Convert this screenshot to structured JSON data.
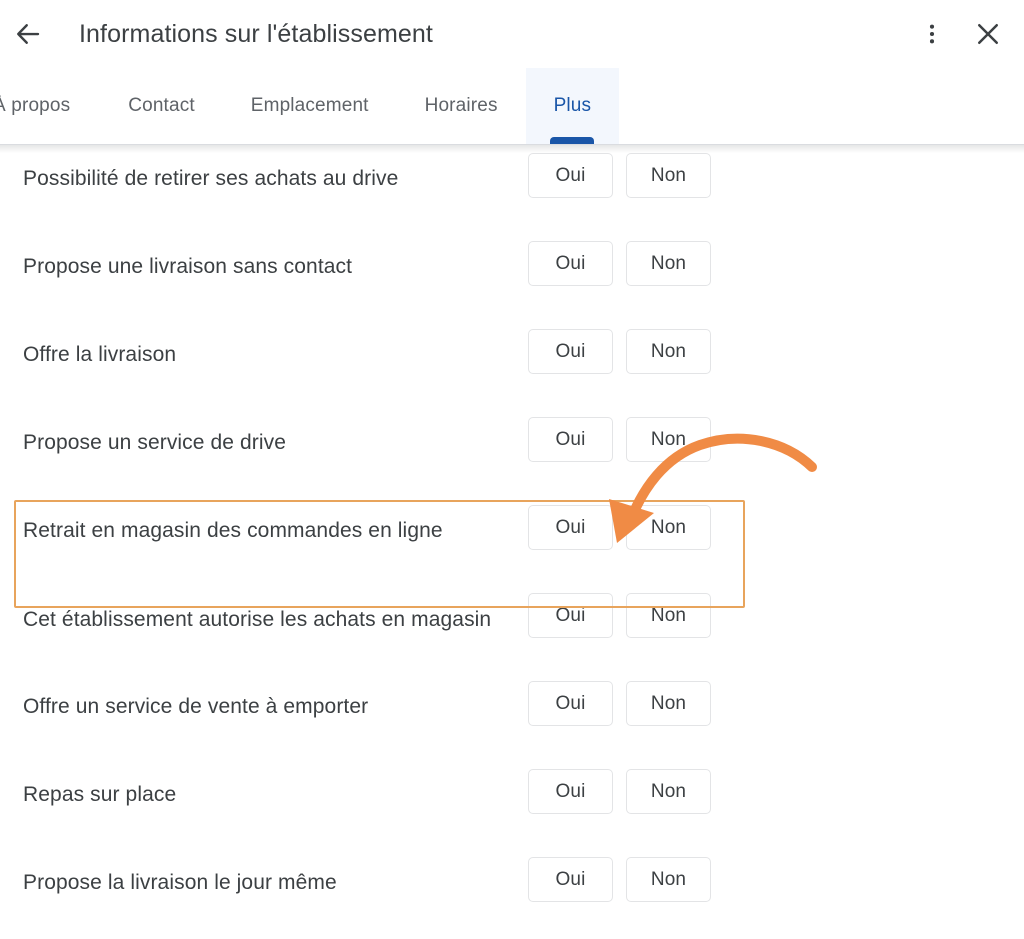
{
  "header": {
    "back_icon": "back-arrow-icon",
    "title": "Informations sur l'établissement",
    "menu_icon": "more-vert-icon",
    "close_icon": "close-icon"
  },
  "tabs": {
    "items": [
      {
        "label": "À propos",
        "active": false
      },
      {
        "label": "Contact",
        "active": false
      },
      {
        "label": "Emplacement",
        "active": false
      },
      {
        "label": "Horaires",
        "active": false
      },
      {
        "label": "Plus",
        "active": true
      }
    ],
    "active_color": "#1a56a8",
    "active_bg": "#f3f7fd",
    "inactive_color": "#5f6368"
  },
  "choices": {
    "yes_label": "Oui",
    "no_label": "Non"
  },
  "attributes": {
    "rows": [
      {
        "label": "Possibilité de retirer ses achats au drive",
        "highlighted": false,
        "two_line": false
      },
      {
        "label": "Propose une livraison sans contact",
        "highlighted": false,
        "two_line": false
      },
      {
        "label": "Offre la livraison",
        "highlighted": false,
        "two_line": false
      },
      {
        "label": "Propose un service de drive",
        "highlighted": false,
        "two_line": false
      },
      {
        "label": "Retrait en magasin des commandes en ligne",
        "highlighted": true,
        "two_line": false
      },
      {
        "label": "Cet établissement autorise les achats en magasin",
        "highlighted": false,
        "two_line": true
      },
      {
        "label": "Offre un service de vente à emporter",
        "highlighted": false,
        "two_line": false
      },
      {
        "label": "Repas sur place",
        "highlighted": false,
        "two_line": false
      },
      {
        "label": "Propose la livraison le jour même",
        "highlighted": false,
        "two_line": false
      }
    ]
  },
  "annotation": {
    "highlight_color": "#e8a45c",
    "arrow_color": "#f08b45",
    "target_row_label": "Retrait en magasin des commandes en ligne",
    "target_choice": "Oui"
  }
}
